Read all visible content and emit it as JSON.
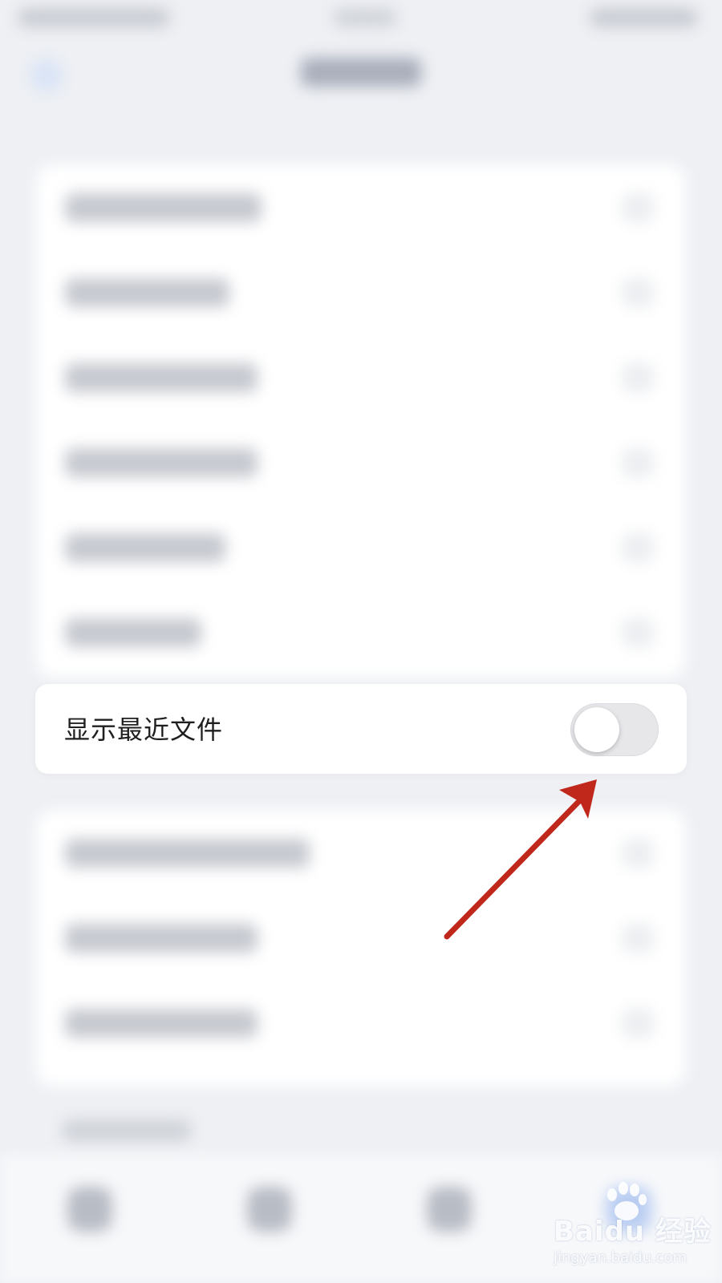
{
  "settings_row": {
    "label": "显示最近文件",
    "toggle_on": false
  },
  "watermark": {
    "logo": "Baidu 经验",
    "url": "jingyan.baidu.com"
  },
  "colors": {
    "arrow": "#c0281b",
    "toggle_track_off": "#e7e7ea",
    "background": "#eef0f4"
  },
  "icons": [
    "back-arrow-icon",
    "chevron-right-icon",
    "pointer-arrow-icon",
    "baidu-paw-icon"
  ]
}
